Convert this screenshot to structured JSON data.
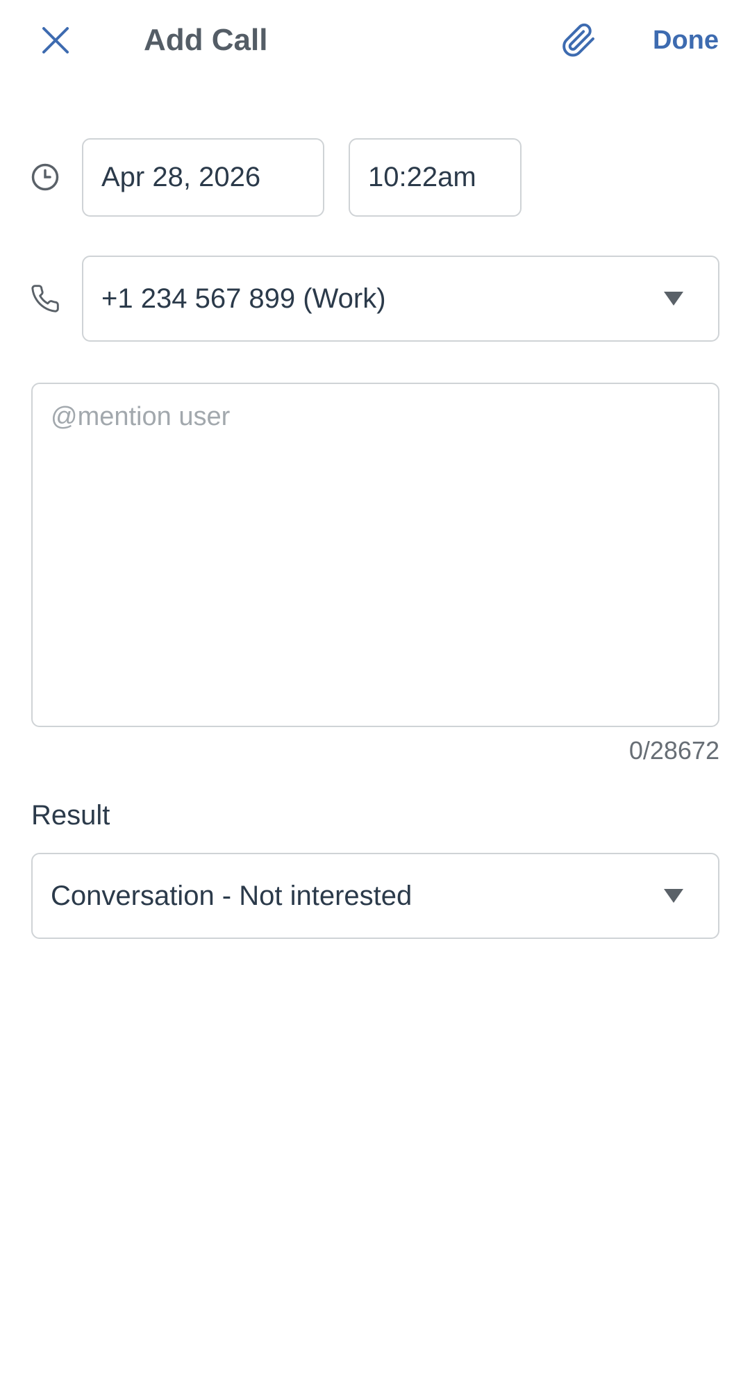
{
  "header": {
    "title": "Add Call",
    "done_label": "Done"
  },
  "datetime": {
    "date": "Apr 28, 2026",
    "time": "10:22am"
  },
  "phone": {
    "selected": "+1 234 567 899 (Work)"
  },
  "notes": {
    "placeholder": "@mention user",
    "value": "",
    "counter": "0/28672"
  },
  "result": {
    "label": "Result",
    "selected": "Conversation - Not interested"
  },
  "colors": {
    "accent": "#3d6bb0",
    "title": "#545d66",
    "text": "#2b3a4a",
    "border": "#cfd3d6",
    "placeholder": "#a2a8ad"
  },
  "icons": {
    "close": "close-icon",
    "attach": "paperclip-icon",
    "clock": "clock-icon",
    "phone": "phone-icon",
    "dropdown": "caret-down-icon"
  }
}
